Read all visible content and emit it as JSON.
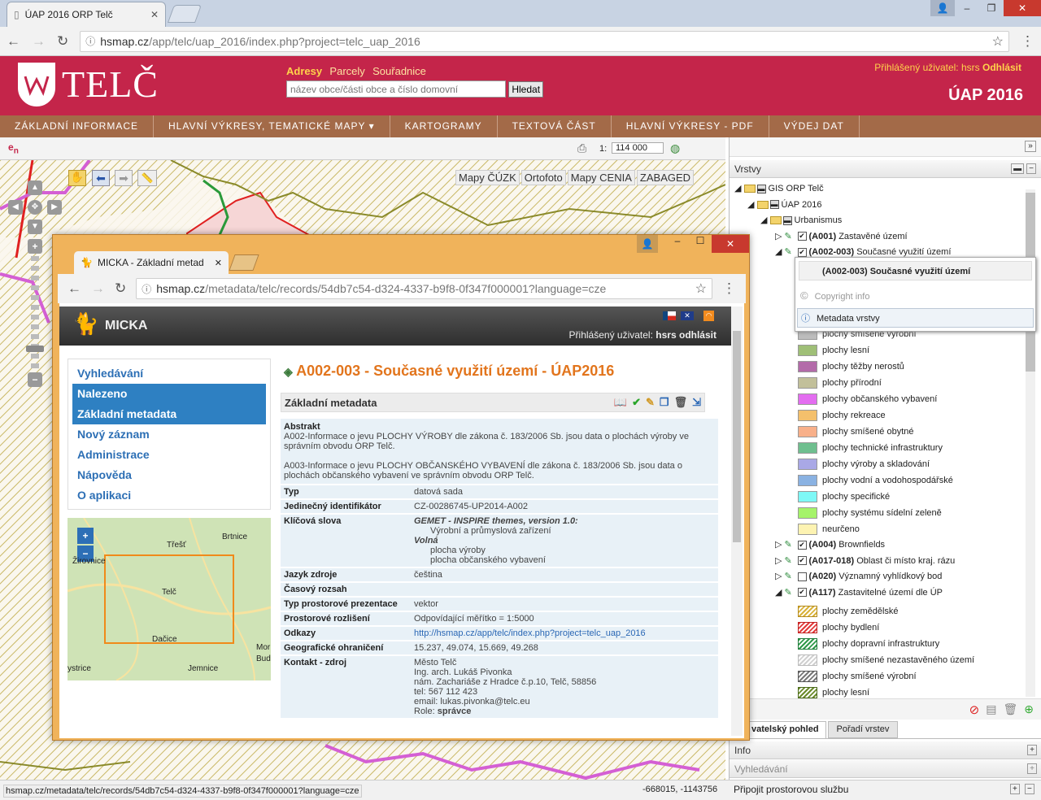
{
  "browser": {
    "tab_title": "ÚAP 2016 ORP Telč",
    "url_host": "hsmap.cz",
    "url_path": "/app/telc/uap_2016/index.php?project=telc_uap_2016"
  },
  "header": {
    "logo_text": "TELČ",
    "search_tabs": [
      "Adresy",
      "Parcely",
      "Souřadnice"
    ],
    "search_placeholder": "název obce/části obce a číslo domovní",
    "search_button": "Hledat",
    "login_label": "Přihlášený uživatel: hsrs",
    "logout": "Odhlásit",
    "app_title": "ÚAP 2016"
  },
  "menu": [
    "ZÁKLADNÍ INFORMACE",
    "HLAVNÍ VÝKRESY, TEMATICKÉ MAPY ▾",
    "KARTOGRAMY",
    "TEXTOVÁ ČÁST",
    "HLAVNÍ VÝKRESY - PDF",
    "VÝDEJ DAT"
  ],
  "maptoolbar": {
    "scale_label": "1:",
    "scale_value": "114 000"
  },
  "map_sources": [
    "Mapy ČÚZK",
    "Ortofoto",
    "Mapy CENIA",
    "ZABAGED"
  ],
  "layers_panel": {
    "title": "Vrstvy",
    "tree": [
      {
        "label": "GIS ORP Telč",
        "lvl": 0,
        "type": "folder"
      },
      {
        "label": "ÚAP 2016",
        "lvl": 1,
        "type": "folder"
      },
      {
        "label": "Urbanismus",
        "lvl": 2,
        "type": "folder"
      },
      {
        "label": "(A001)",
        "rest": " Zastavěné území",
        "lvl": 3,
        "type": "layer",
        "checked": true
      },
      {
        "label": "(A002-003)",
        "rest": " Současné využití území",
        "lvl": 3,
        "type": "layer",
        "checked": true
      }
    ],
    "legend1": [
      {
        "label": "plochy smíšené výrobní",
        "color": "#bdbdbd"
      },
      {
        "label": "plochy lesní",
        "color": "#9fbf77"
      },
      {
        "label": "plochy těžby nerostů",
        "color": "#b36ba9"
      },
      {
        "label": "plochy přírodní",
        "color": "#c2c09a"
      },
      {
        "label": "plochy občanského vybavení",
        "color": "#e36df0"
      },
      {
        "label": "plochy rekreace",
        "color": "#f4c06c"
      },
      {
        "label": "plochy smíšené obytné",
        "color": "#f8b08a"
      },
      {
        "label": "plochy technické infrastruktury",
        "color": "#6fbf8f"
      },
      {
        "label": "plochy výroby a skladování",
        "color": "#a9a8e6"
      },
      {
        "label": "plochy vodní a vodohospodářské",
        "color": "#8ab2e2"
      },
      {
        "label": "plochy specifické",
        "color": "#7ef8f6"
      },
      {
        "label": "plochy systému sídelní zeleně",
        "color": "#a5f36a"
      },
      {
        "label": "neurčeno",
        "color": "#fdf3b2"
      }
    ],
    "layers2": [
      {
        "label": "(A004)",
        "rest": " Brownfields",
        "checked": true
      },
      {
        "label": "(A017-018)",
        "rest": " Oblast či místo kraj. rázu",
        "checked": true
      },
      {
        "label": "(A020)",
        "rest": " Významný vyhlídkový bod",
        "checked": false
      },
      {
        "label": "(A117)",
        "rest": " Zastavitelné území dle ÚP",
        "checked": true
      }
    ],
    "legend2": [
      {
        "label": "plochy zemědělské",
        "color": "#d9b23a"
      },
      {
        "label": "plochy bydlení",
        "color": "#e23a3a"
      },
      {
        "label": "plochy dopravní infrastruktury",
        "color": "#2f9a4a"
      },
      {
        "label": "plochy smíšené nezastavěného území",
        "color": "#d0d0d0"
      },
      {
        "label": "plochy smíšené výrobní",
        "color": "#777777"
      },
      {
        "label": "plochy lesní",
        "color": "#6a8a2a"
      }
    ],
    "tabs": [
      "vatelský pohled",
      "Pořadí vrstev"
    ],
    "bottom_sections": [
      "Info",
      "Vyhledávání",
      "Připojit prostorovou službu"
    ]
  },
  "context_menu": {
    "title": "(A002-003) Současné využití území",
    "copyright": "Copyright info",
    "metadata": "Metadata vrstvy"
  },
  "status": {
    "url": "hsmap.cz/metadata/telc/records/54db7c54-d324-4337-b9f8-0f347f000001?language=cze",
    "coords": "-668015, -1143756"
  },
  "popup": {
    "tab_title": "MICKA - Základní metad",
    "url_host": "hsmap.cz",
    "url_path": "/metadata/telc/records/54db7c54-d324-4337-b9f8-0f347f000001?language=cze",
    "brand": "MICKA",
    "login": "Přihlášený uživatel:",
    "user": "hsrs",
    "logout": "odhlásit",
    "side": [
      "Vyhledávání",
      "Nalezeno",
      "Základní metadata",
      "Nový záznam",
      "Administrace",
      "Nápověda",
      "O aplikaci"
    ],
    "map_labels": [
      "Třešť",
      "Brtnice",
      "Telč",
      "Dačice",
      "Jemnice",
      "Žirovnice",
      "ystrice",
      "Mor",
      "Bud"
    ],
    "title": "A002-003 - Současné využití území - ÚAP2016",
    "section": "Základní metadata",
    "abstract_label": "Abstrakt",
    "abstract1": "A002-Informace o jevu PLOCHY VÝROBY dle zákona č. 183/2006 Sb. jsou data o plochách výroby ve správním obvodu ORP Telč.",
    "abstract2": "A003-Informace o jevu PLOCHY OBČANSKÉHO VYBAVENÍ dle zákona č. 183/2006 Sb. jsou data o plochách občanského vybavení ve správním obvodu ORP Telč.",
    "rows": [
      {
        "k": "Typ",
        "v": "datová sada"
      },
      {
        "k": "Jedinečný identifikátor",
        "v": "CZ-00286745-UP2014-A002"
      },
      {
        "k": "Klíčová slova",
        "v1": "GEMET - INSPIRE themes, version 1.0:",
        "v2": "Výrobní a průmyslová zařízení",
        "v3": "Volná",
        "v4": "plocha výroby",
        "v5": "plocha občanského vybavení"
      },
      {
        "k": "Jazyk zdroje",
        "v": "čeština"
      },
      {
        "k": "Časový rozsah",
        "v": ""
      },
      {
        "k": "Typ prostorové prezentace",
        "v": "vektor"
      },
      {
        "k": "Prostorové rozlišení",
        "v": "Odpovídající měřítko = 1:5000"
      },
      {
        "k": "Odkazy",
        "v": "http://hsmap.cz/app/telc/index.php?project=telc_uap_2016"
      },
      {
        "k": "Geografické ohraničení",
        "v": "15.237, 49.074, 15.669, 49.268"
      },
      {
        "k": "Kontakt - zdroj",
        "c": [
          "Město Telč",
          "Ing. arch. Lukáš Pivonka",
          "nám. Zachariáše z Hradce č.p.10, Telč, 58856",
          "tel: 567 112 423",
          "email: lukas.pivonka@telc.eu"
        ],
        "role_label": "Role:",
        "role": "správce"
      }
    ]
  }
}
